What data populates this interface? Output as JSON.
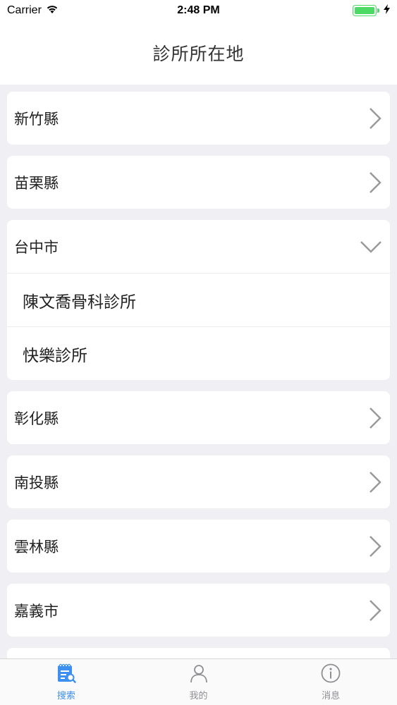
{
  "status_bar": {
    "carrier": "Carrier",
    "time": "2:48 PM"
  },
  "nav": {
    "title": "診所所在地"
  },
  "regions": [
    {
      "label": "新竹縣",
      "expanded": false
    },
    {
      "label": "苗栗縣",
      "expanded": false
    },
    {
      "label": "台中市",
      "expanded": true,
      "clinics": [
        "陳文喬骨科診所",
        "快樂診所"
      ]
    },
    {
      "label": "彰化縣",
      "expanded": false
    },
    {
      "label": "南投縣",
      "expanded": false
    },
    {
      "label": "雲林縣",
      "expanded": false
    },
    {
      "label": "嘉義市",
      "expanded": false
    }
  ],
  "tabs": [
    {
      "label": "搜索",
      "icon": "search-doc-icon",
      "active": true
    },
    {
      "label": "我的",
      "icon": "person-icon",
      "active": false
    },
    {
      "label": "消息",
      "icon": "info-icon",
      "active": false
    }
  ],
  "colors": {
    "accent": "#3d8ff0",
    "battery": "#4cd964",
    "background": "#f0eff4",
    "chevron": "#9a9a9a"
  }
}
